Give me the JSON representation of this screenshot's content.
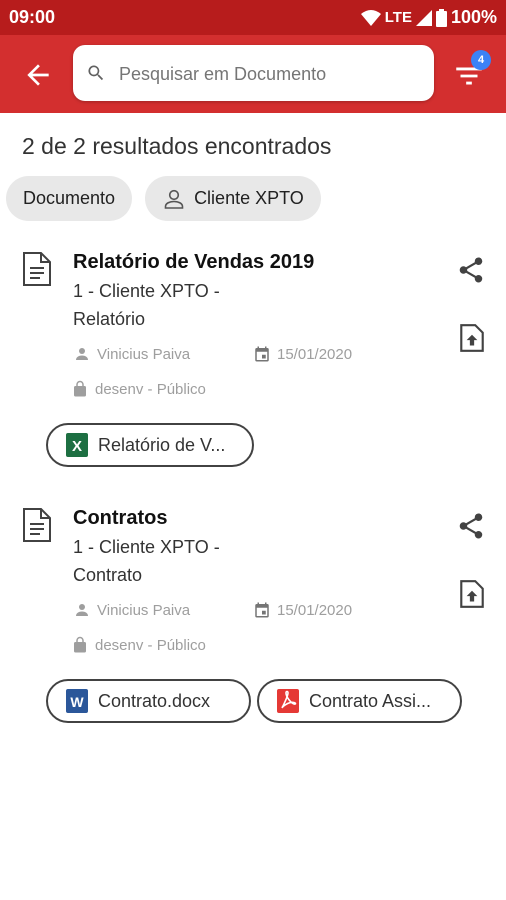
{
  "status_bar": {
    "time": "09:00",
    "network": "LTE",
    "battery": "100%"
  },
  "header": {
    "search_placeholder": "Pesquisar em Documento",
    "filter_count": "4"
  },
  "results_text": "2 de 2 resultados encontrados",
  "chips": [
    {
      "label": "Documento"
    },
    {
      "label": "Cliente XPTO"
    }
  ],
  "documents": [
    {
      "title": "Relatório de Vendas 2019",
      "subtitle_line1": "1 - Cliente XPTO -",
      "subtitle_line2": "Relatório",
      "author": "Vinicius Paiva",
      "date": "15/01/2020",
      "access": "desenv - Público",
      "files": [
        {
          "name": "Relatório de V...",
          "type": "xlsx-icon"
        }
      ]
    },
    {
      "title": "Contratos",
      "subtitle_line1": "1 - Cliente XPTO -",
      "subtitle_line2": "Contrato",
      "author": "Vinicius Paiva",
      "date": "15/01/2020",
      "access": "desenv - Público",
      "files": [
        {
          "name": "Contrato.docx",
          "type": "docx-icon"
        },
        {
          "name": "Contrato Assi...",
          "type": "pdf-icon"
        }
      ]
    }
  ],
  "colors": {
    "status_bar": "#b71c1c",
    "app_bar": "#d32f2f",
    "badge": "#3b82f6",
    "excel": "#1d6f42",
    "word": "#2b579a",
    "pdf": "#e53935"
  }
}
